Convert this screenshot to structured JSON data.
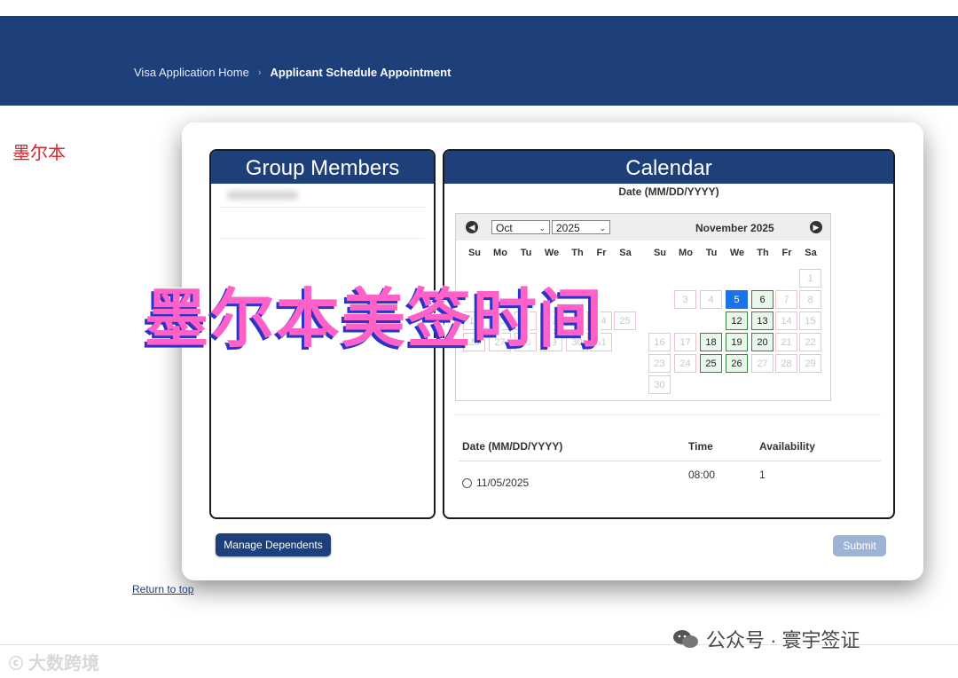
{
  "header": {
    "breadcrumb_home": "Visa Application Home",
    "breadcrumb_sep": "›",
    "breadcrumb_current": "Applicant Schedule Appointment"
  },
  "city_label": "墨尔本",
  "group_panel": {
    "title": "Group Members"
  },
  "calendar_panel": {
    "title": "Calendar",
    "date_label": "Date (MM/DD/YYYY)",
    "month_select": "Oct",
    "year_select": "2025",
    "right_month_title": "November 2025",
    "weekdays": [
      "Su",
      "Mo",
      "Tu",
      "We",
      "Th",
      "Fr",
      "Sa"
    ],
    "left_month_days": [
      "19",
      "20",
      "21",
      "22",
      "23",
      "24",
      "25",
      "26",
      "27",
      "28",
      "29",
      "30",
      "31"
    ],
    "right_month": {
      "row1": [
        "1"
      ],
      "row2": [
        "3",
        "4",
        "5",
        "6",
        "7",
        "8"
      ],
      "row3": [
        "12",
        "13",
        "14",
        "15"
      ],
      "row4": [
        "16",
        "17",
        "18",
        "19",
        "20",
        "21",
        "22"
      ],
      "row5": [
        "23",
        "24",
        "25",
        "26",
        "27",
        "28",
        "29"
      ],
      "row6": [
        "30"
      ],
      "available": [
        "6",
        "12",
        "13",
        "18",
        "19",
        "20",
        "25",
        "26"
      ],
      "selected": "5"
    }
  },
  "slots": {
    "headers": {
      "date": "Date (MM/DD/YYYY)",
      "time": "Time",
      "availability": "Availability"
    },
    "rows": [
      {
        "date": "11/05/2025",
        "time": "08:00",
        "availability": "1"
      }
    ]
  },
  "buttons": {
    "manage": "Manage Dependents",
    "submit": "Submit"
  },
  "return_to_top": "Return to top",
  "overlay_text": "墨尔本美签时间",
  "watermark_right": "公众号 · 寰宇签证",
  "watermark_left": "大数跨境",
  "colors": {
    "header": "#1d3f7a",
    "available": "#2e8b3b",
    "selected": "#1a73e8",
    "overlay": "#ff61c8"
  }
}
